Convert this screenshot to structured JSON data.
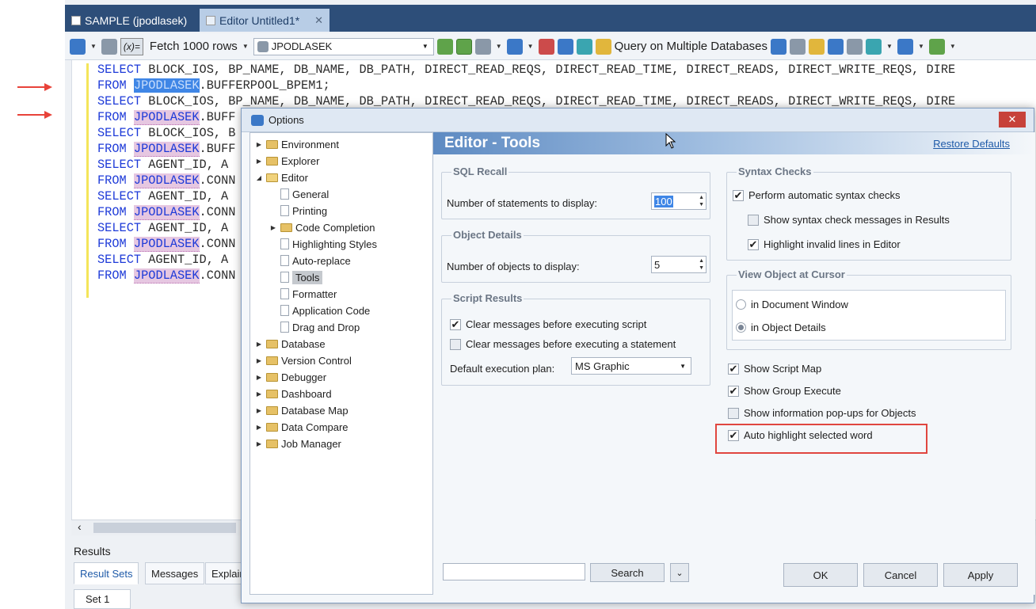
{
  "tabs": [
    {
      "label": "SAMPLE (jpodlasek)"
    },
    {
      "label": "Editor Untitled1*",
      "close": "✕"
    }
  ],
  "toolbar": {
    "fetch_label": "Fetch 1000 rows",
    "variable_label": "(x)=",
    "schema_value": "JPODLASEK",
    "query_multi_label": "Query on Multiple Databases"
  },
  "editor": {
    "lines": [
      {
        "kw": "SELECT",
        "a": " BLOCK_IOS, BP_NAME, DB_NAME, DB_PATH, DIRECT_READ_REQS, DIRECT_READ_TIME, DIRECT_READS, DIRECT_WRITE_REQS, DIRE",
        "hl": "",
        "b": ""
      },
      {
        "kw": "FROM",
        "a": " ",
        "hl": "JPODLASEK",
        "b": ".BUFFERPOOL_BPEM1;"
      },
      {
        "kw": "SELECT",
        "a": " BLOCK_IOS, BP_NAME, DB_NAME, DB_PATH, DIRECT_READ_REQS, DIRECT_READ_TIME, DIRECT_READS, DIRECT_WRITE_REQS, DIRE",
        "hl": "",
        "b": ""
      },
      {
        "kw": "FROM",
        "a": " ",
        "hl": "JPODLASEK",
        "b": ".BUFF"
      },
      {
        "kw": "SELECT",
        "a": " BLOCK_IOS, B",
        "hl": "",
        "b": ""
      },
      {
        "kw": "FROM",
        "a": " ",
        "hl": "JPODLASEK",
        "b": ".BUFF"
      },
      {
        "kw": "SELECT",
        "a": " AGENT_ID, A",
        "hl": "",
        "b": ""
      },
      {
        "kw": "FROM",
        "a": " ",
        "hl": "JPODLASEK",
        "b": ".CONN"
      },
      {
        "kw": "SELECT",
        "a": " AGENT_ID, A",
        "hl": "",
        "b": ""
      },
      {
        "kw": "FROM",
        "a": " ",
        "hl": "JPODLASEK",
        "b": ".CONN"
      },
      {
        "kw": "SELECT",
        "a": " AGENT_ID, A",
        "hl": "",
        "b": ""
      },
      {
        "kw": "FROM",
        "a": " ",
        "hl": "JPODLASEK",
        "b": ".CONN"
      },
      {
        "kw": "SELECT",
        "a": " AGENT_ID, A",
        "hl": "",
        "b": ""
      },
      {
        "kw": "FROM",
        "a": " ",
        "hl": "JPODLASEK",
        "b": ".CONN"
      }
    ]
  },
  "results": {
    "title": "Results",
    "tabs": [
      "Result Sets",
      "Messages",
      "Explain"
    ],
    "set_tab": "Set 1"
  },
  "dialog": {
    "title": "Options",
    "close": "✕",
    "tree": [
      {
        "label": "Environment",
        "type": "folder",
        "level": 0,
        "expander": "▶"
      },
      {
        "label": "Explorer",
        "type": "folder",
        "level": 0,
        "expander": "▶"
      },
      {
        "label": "Editor",
        "type": "folder-open",
        "level": 0,
        "expander": "◢"
      },
      {
        "label": "General",
        "type": "page",
        "level": 1,
        "expander": ""
      },
      {
        "label": "Printing",
        "type": "page",
        "level": 1,
        "expander": ""
      },
      {
        "label": "Code Completion",
        "type": "folder",
        "level": 1,
        "expander": "▶"
      },
      {
        "label": "Highlighting Styles",
        "type": "page",
        "level": 1,
        "expander": ""
      },
      {
        "label": "Auto-replace",
        "type": "page",
        "level": 1,
        "expander": ""
      },
      {
        "label": "Tools",
        "type": "page",
        "level": 1,
        "expander": "",
        "selected": true
      },
      {
        "label": "Formatter",
        "type": "page",
        "level": 1,
        "expander": ""
      },
      {
        "label": "Application Code",
        "type": "page",
        "level": 1,
        "expander": ""
      },
      {
        "label": "Drag and Drop",
        "type": "page",
        "level": 1,
        "expander": ""
      },
      {
        "label": "Database",
        "type": "folder",
        "level": 0,
        "expander": "▶"
      },
      {
        "label": "Version Control",
        "type": "folder",
        "level": 0,
        "expander": "▶"
      },
      {
        "label": "Debugger",
        "type": "folder",
        "level": 0,
        "expander": "▶"
      },
      {
        "label": "Dashboard",
        "type": "folder",
        "level": 0,
        "expander": "▶"
      },
      {
        "label": "Database Map",
        "type": "folder",
        "level": 0,
        "expander": "▶"
      },
      {
        "label": "Data Compare",
        "type": "folder",
        "level": 0,
        "expander": "▶"
      },
      {
        "label": "Job Manager",
        "type": "folder",
        "level": 0,
        "expander": "▶"
      }
    ],
    "panel": {
      "title": "Editor - Tools",
      "restore_defaults": "Restore Defaults",
      "sql_recall": {
        "title": "SQL Recall",
        "label": "Number of statements to display:",
        "value": "100"
      },
      "object_details": {
        "title": "Object Details",
        "label": "Number of objects to display:",
        "value": "5"
      },
      "script_results": {
        "title": "Script Results",
        "clear_script": "Clear messages before executing script",
        "clear_statement": "Clear messages before executing a statement",
        "plan_label": "Default execution plan:",
        "plan_value": "MS Graphic"
      },
      "syntax_checks": {
        "title": "Syntax Checks",
        "auto": "Perform automatic syntax checks",
        "show_messages": "Show syntax check messages in Results",
        "highlight_invalid": "Highlight invalid lines in Editor"
      },
      "view_object": {
        "title": "View Object at Cursor",
        "doc_window": "in Document Window",
        "object_details": "in Object Details"
      },
      "show_script_map": "Show Script Map",
      "show_group_execute": "Show Group Execute",
      "show_info_popups": "Show information pop-ups for Objects",
      "auto_highlight": "Auto highlight selected word",
      "search_button": "Search",
      "ok": "OK",
      "cancel": "Cancel",
      "apply": "Apply"
    }
  }
}
